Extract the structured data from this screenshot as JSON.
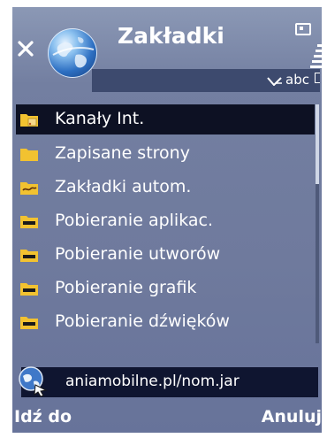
{
  "header": {
    "title": "Zakładki",
    "input_mode": "abc"
  },
  "list": {
    "items": [
      {
        "label": "Kanały Int.",
        "icon": "feed-folder-icon",
        "selected": true
      },
      {
        "label": "Zapisane strony",
        "icon": "folder-icon",
        "selected": false
      },
      {
        "label": "Zakładki autom.",
        "icon": "auto-bookmarks-folder-icon",
        "selected": false
      },
      {
        "label": "Pobieranie aplikac.",
        "icon": "download-folder-icon",
        "selected": false
      },
      {
        "label": "Pobieranie utworów",
        "icon": "download-folder-icon",
        "selected": false
      },
      {
        "label": "Pobieranie grafik",
        "icon": "download-folder-icon",
        "selected": false
      },
      {
        "label": "Pobieranie dźwięków",
        "icon": "download-folder-icon",
        "selected": false
      }
    ]
  },
  "address": {
    "value": "aniamobilne.pl/nom.jar"
  },
  "softkeys": {
    "left": "Idź do",
    "right": "Anuluj"
  },
  "colors": {
    "background_top": "#8b98b5",
    "background_bottom": "#67739a",
    "selection": "#0d1123",
    "folder_yellow": "#f2c230"
  }
}
